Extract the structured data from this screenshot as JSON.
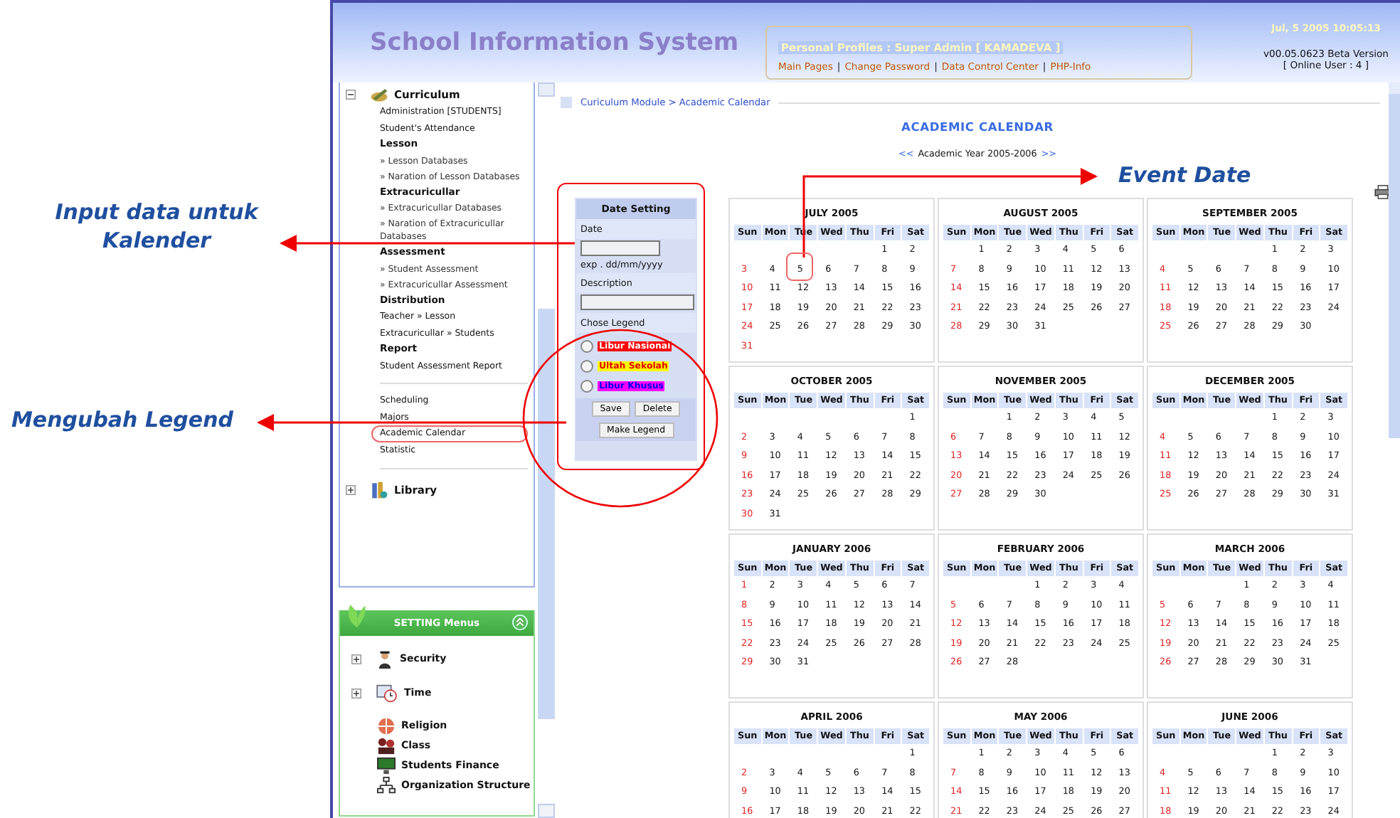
{
  "annotations": [
    {
      "text": "Input data untuk Kalender",
      "kind": "input"
    },
    {
      "text": "Mengubah Legend",
      "kind": "legend"
    },
    {
      "text": "Event Date",
      "kind": "event"
    }
  ],
  "header": {
    "title": "School Information System",
    "profile_title": "Personal Profiles : Super Admin [ KAMADEVA ]",
    "links": [
      "Main Pages",
      "Change Password",
      "Data Control Center",
      "PHP-Info"
    ],
    "separator": "|",
    "datetime": "Jul, 5 2005 10:05:13",
    "version": "v00.05.0623 Beta Version",
    "online": "[ Online User : 4 ]"
  },
  "sidebar": {
    "section": {
      "title": "Curriculum",
      "expanded": true
    },
    "items": [
      {
        "text": "Administration [STUDENTS]",
        "kind": "item"
      },
      {
        "text": "Student's Attendance",
        "kind": "item"
      },
      {
        "text": "Lesson",
        "kind": "heading"
      },
      {
        "text": "» Lesson Databases",
        "kind": "sub"
      },
      {
        "text": "» Naration of Lesson Databases",
        "kind": "sub"
      },
      {
        "text": "Extracuricullar",
        "kind": "heading"
      },
      {
        "text": "» Extracuricullar Databases",
        "kind": "sub"
      },
      {
        "text": "» Naration of Extracuricullar Databases",
        "kind": "sub"
      },
      {
        "text": "Assessment",
        "kind": "heading"
      },
      {
        "text": "» Student Assessment",
        "kind": "sub"
      },
      {
        "text": "» Extracuricullar Assessment",
        "kind": "sub"
      },
      {
        "text": "Distribution",
        "kind": "heading"
      },
      {
        "text": "Teacher » Lesson",
        "kind": "item"
      },
      {
        "text": "Extracuricullar » Students",
        "kind": "item"
      },
      {
        "text": "Report",
        "kind": "heading"
      },
      {
        "text": "Student Assessment Report",
        "kind": "item"
      }
    ],
    "extra_items": [
      {
        "text": "Scheduling",
        "circled": false
      },
      {
        "text": "Majors",
        "circled": false
      },
      {
        "text": "Academic Calendar",
        "circled": true
      },
      {
        "text": "Statistic",
        "circled": false
      }
    ],
    "library": {
      "title": "Library",
      "expanded": false
    },
    "settings": {
      "title": "SETTING Menus",
      "items": [
        {
          "text": "Security",
          "kind": "group",
          "expanded": false
        },
        {
          "text": "Time",
          "kind": "group",
          "expanded": false
        },
        {
          "text": "Religion",
          "kind": "leaf"
        },
        {
          "text": "Class",
          "kind": "leaf"
        },
        {
          "text": "Students Finance",
          "kind": "leaf"
        },
        {
          "text": "Organization Structure",
          "kind": "leaf"
        }
      ]
    }
  },
  "breadcrumb": "Curiculum Module > Academic Calendar",
  "page_title": "ACADEMIC CALENDAR",
  "year_nav": {
    "prev": "<<",
    "text": "Academic Year 2005-2006",
    "next": ">>"
  },
  "form": {
    "title": "Date Setting",
    "date_label": "Date",
    "date_hint": "exp . dd/mm/yyyy",
    "description_label": "Description",
    "legend_label": "Chose Legend",
    "legends": [
      {
        "text": "Libur Nasional",
        "color": "#ff0000",
        "selected": false
      },
      {
        "text": "Ultah Sekolah",
        "color": "#ffff00",
        "selected": false
      },
      {
        "text": "Libur Khusus",
        "color": "#ff00ff",
        "selected": false
      }
    ],
    "buttons": [
      "Save",
      "Delete"
    ],
    "make_button": "Make Legend"
  },
  "months": [
    {
      "title": "JULY 2005",
      "weekdays": [
        "Sun",
        "Mon",
        "Tue",
        "Wed",
        "Thu",
        "Fri",
        "Sat"
      ],
      "weeks": [
        [
          "1",
          "2"
        ],
        [
          "3",
          "4",
          "5",
          "6",
          "7",
          "8",
          "9"
        ],
        [
          "10",
          "11",
          "12",
          "13",
          "14",
          "15",
          "16"
        ],
        [
          "17",
          "18",
          "19",
          "20",
          "21",
          "22",
          "23"
        ],
        [
          "24",
          "25",
          "26",
          "27",
          "28",
          "29",
          "30"
        ],
        [
          "31"
        ]
      ]
    },
    {
      "title": "AUGUST 2005",
      "weekdays": [
        "Sun",
        "Mon",
        "Tue",
        "Wed",
        "Thu",
        "Fri",
        "Sat"
      ],
      "weeks": [
        [
          "1",
          "2",
          "3",
          "4",
          "5",
          "6"
        ],
        [
          "7",
          "8",
          "9",
          "10",
          "11",
          "12",
          "13"
        ],
        [
          "14",
          "15",
          "16",
          "17",
          "18",
          "19",
          "20"
        ],
        [
          "21",
          "22",
          "23",
          "24",
          "25",
          "26",
          "27"
        ],
        [
          "28",
          "29",
          "30",
          "31"
        ]
      ]
    },
    {
      "title": "SEPTEMBER 2005",
      "weekdays": [
        "Sun",
        "Mon",
        "Tue",
        "Wed",
        "Thu",
        "Fri",
        "Sat"
      ],
      "weeks": [
        [
          "1",
          "2",
          "3"
        ],
        [
          "4",
          "5",
          "6",
          "7",
          "8",
          "9",
          "10"
        ],
        [
          "11",
          "12",
          "13",
          "14",
          "15",
          "16",
          "17"
        ],
        [
          "18",
          "19",
          "20",
          "21",
          "22",
          "23",
          "24"
        ],
        [
          "25",
          "26",
          "27",
          "28",
          "29",
          "30"
        ]
      ]
    },
    {
      "title": "OCTOBER 2005",
      "weekdays": [
        "Sun",
        "Mon",
        "Tue",
        "Wed",
        "Thu",
        "Fri",
        "Sat"
      ],
      "weeks": [
        [
          "1"
        ],
        [
          "2",
          "3",
          "4",
          "5",
          "6",
          "7",
          "8"
        ],
        [
          "9",
          "10",
          "11",
          "12",
          "13",
          "14",
          "15"
        ],
        [
          "16",
          "17",
          "18",
          "19",
          "20",
          "21",
          "22"
        ],
        [
          "23",
          "24",
          "25",
          "26",
          "27",
          "28",
          "29"
        ],
        [
          "30",
          "31"
        ]
      ]
    },
    {
      "title": "NOVEMBER 2005",
      "weekdays": [
        "Sun",
        "Mon",
        "Tue",
        "Wed",
        "Thu",
        "Fri",
        "Sat"
      ],
      "weeks": [
        [
          "1",
          "2",
          "3",
          "4",
          "5"
        ],
        [
          "6",
          "7",
          "8",
          "9",
          "10",
          "11",
          "12"
        ],
        [
          "13",
          "14",
          "15",
          "16",
          "17",
          "18",
          "19"
        ],
        [
          "20",
          "21",
          "22",
          "23",
          "24",
          "25",
          "26"
        ],
        [
          "27",
          "28",
          "29",
          "30"
        ]
      ]
    },
    {
      "title": "DECEMBER 2005",
      "weekdays": [
        "Sun",
        "Mon",
        "Tue",
        "Wed",
        "Thu",
        "Fri",
        "Sat"
      ],
      "weeks": [
        [
          "1",
          "2",
          "3"
        ],
        [
          "4",
          "5",
          "6",
          "7",
          "8",
          "9",
          "10"
        ],
        [
          "11",
          "12",
          "13",
          "14",
          "15",
          "16",
          "17"
        ],
        [
          "18",
          "19",
          "20",
          "21",
          "22",
          "23",
          "24"
        ],
        [
          "25",
          "26",
          "27",
          "28",
          "29",
          "30",
          "31"
        ]
      ]
    },
    {
      "title": "JANUARY 2006",
      "weekdays": [
        "Sun",
        "Mon",
        "Tue",
        "Wed",
        "Thu",
        "Fri",
        "Sat"
      ],
      "weeks": [
        [
          "1",
          "2",
          "3",
          "4",
          "5",
          "6",
          "7"
        ],
        [
          "8",
          "9",
          "10",
          "11",
          "12",
          "13",
          "14"
        ],
        [
          "15",
          "16",
          "17",
          "18",
          "19",
          "20",
          "21"
        ],
        [
          "22",
          "23",
          "24",
          "25",
          "26",
          "27",
          "28"
        ],
        [
          "29",
          "30",
          "31"
        ]
      ]
    },
    {
      "title": "FEBRUARY 2006",
      "weekdays": [
        "Sun",
        "Mon",
        "Tue",
        "Wed",
        "Thu",
        "Fri",
        "Sat"
      ],
      "weeks": [
        [
          "1",
          "2",
          "3",
          "4"
        ],
        [
          "5",
          "6",
          "7",
          "8",
          "9",
          "10",
          "11"
        ],
        [
          "12",
          "13",
          "14",
          "15",
          "16",
          "17",
          "18"
        ],
        [
          "19",
          "20",
          "21",
          "22",
          "23",
          "24",
          "25"
        ],
        [
          "26",
          "27",
          "28"
        ]
      ]
    },
    {
      "title": "MARCH 2006",
      "weekdays": [
        "Sun",
        "Mon",
        "Tue",
        "Wed",
        "Thu",
        "Fri",
        "Sat"
      ],
      "weeks": [
        [
          "1",
          "2",
          "3",
          "4"
        ],
        [
          "5",
          "6",
          "7",
          "8",
          "9",
          "10",
          "11"
        ],
        [
          "12",
          "13",
          "14",
          "15",
          "16",
          "17",
          "18"
        ],
        [
          "19",
          "20",
          "21",
          "22",
          "23",
          "24",
          "25"
        ],
        [
          "26",
          "27",
          "28",
          "29",
          "30",
          "31"
        ]
      ]
    },
    {
      "title": "APRIL 2006",
      "weekdays": [
        "Sun",
        "Mon",
        "Tue",
        "Wed",
        "Thu",
        "Fri",
        "Sat"
      ],
      "weeks": [
        [
          "1"
        ],
        [
          "2",
          "3",
          "4",
          "5",
          "6",
          "7",
          "8"
        ],
        [
          "9",
          "10",
          "11",
          "12",
          "13",
          "14",
          "15"
        ],
        [
          "16",
          "17",
          "18",
          "19",
          "20",
          "21",
          "22"
        ]
      ]
    },
    {
      "title": "MAY 2006",
      "weekdays": [
        "Sun",
        "Mon",
        "Tue",
        "Wed",
        "Thu",
        "Fri",
        "Sat"
      ],
      "weeks": [
        [
          "1",
          "2",
          "3",
          "4",
          "5",
          "6"
        ],
        [
          "7",
          "8",
          "9",
          "10",
          "11",
          "12",
          "13"
        ],
        [
          "14",
          "15",
          "16",
          "17",
          "18",
          "19",
          "20"
        ],
        [
          "21",
          "22",
          "23",
          "24",
          "25",
          "26",
          "27"
        ]
      ]
    },
    {
      "title": "JUNE 2006",
      "weekdays": [
        "Sun",
        "Mon",
        "Tue",
        "Wed",
        "Thu",
        "Fri",
        "Sat"
      ],
      "weeks": [
        [
          "1",
          "2",
          "3"
        ],
        [
          "4",
          "5",
          "6",
          "7",
          "8",
          "9",
          "10"
        ],
        [
          "11",
          "12",
          "13",
          "14",
          "15",
          "16",
          "17"
        ],
        [
          "18",
          "19",
          "20",
          "21",
          "22",
          "23",
          "24"
        ]
      ]
    }
  ]
}
